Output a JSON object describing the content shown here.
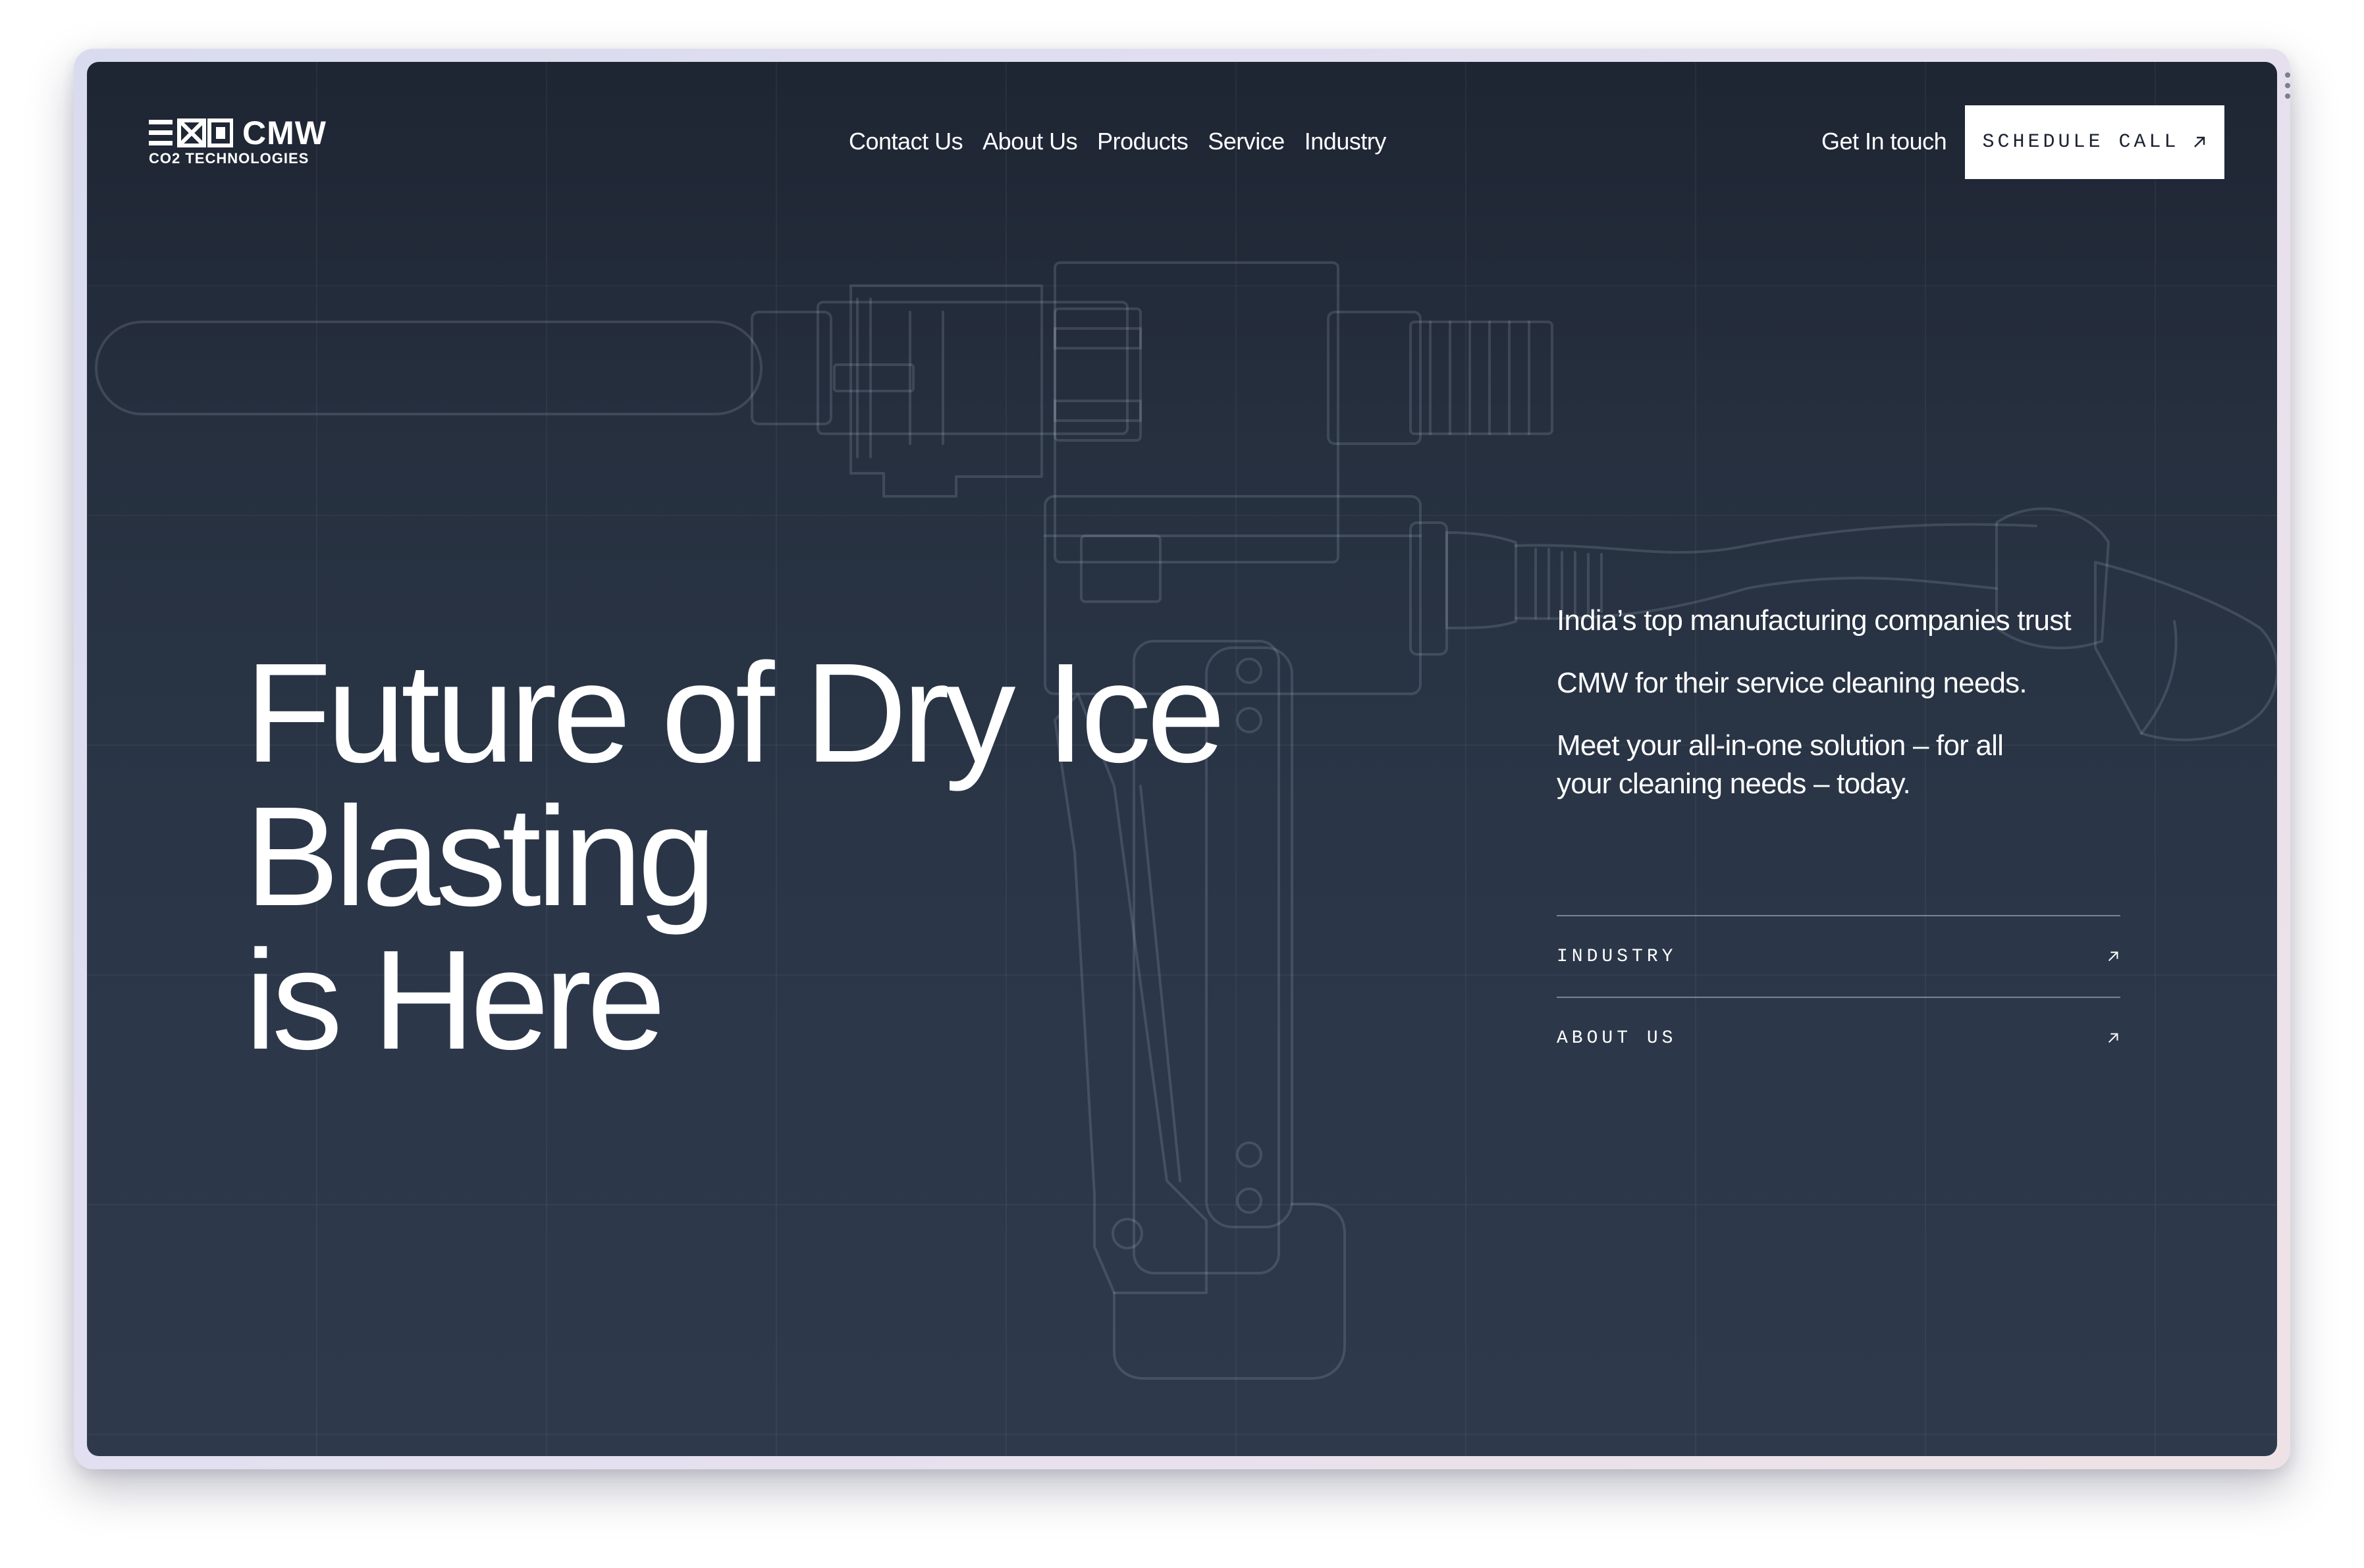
{
  "brand": {
    "name": "CMW",
    "tagline": "CO2 TECHNOLOGIES"
  },
  "nav": {
    "items": [
      {
        "label": "Contact Us"
      },
      {
        "label": "About Us"
      },
      {
        "label": "Products"
      },
      {
        "label": "Service"
      },
      {
        "label": "Industry"
      }
    ],
    "get_in_touch": "Get In touch",
    "cta_label": "SCHEDULE CALL",
    "cta_icon": "arrow-up-right-icon"
  },
  "hero": {
    "title_lines": [
      "Future of Dry Ice",
      "Blasting",
      "is Here"
    ]
  },
  "side": {
    "paragraphs": [
      "India’s top manufacturing companies trust",
      "CMW for their service cleaning needs.",
      "Meet your all-in-one solution – for all your cleaning needs – today."
    ]
  },
  "links": [
    {
      "label": "INDUSTRY",
      "icon": "arrow-up-right-icon"
    },
    {
      "label": "ABOUT US",
      "icon": "arrow-up-right-icon"
    }
  ],
  "colors": {
    "background": "#26303f",
    "text": "#ffffff",
    "cta_background": "#ffffff",
    "cta_text": "#1c2230"
  }
}
